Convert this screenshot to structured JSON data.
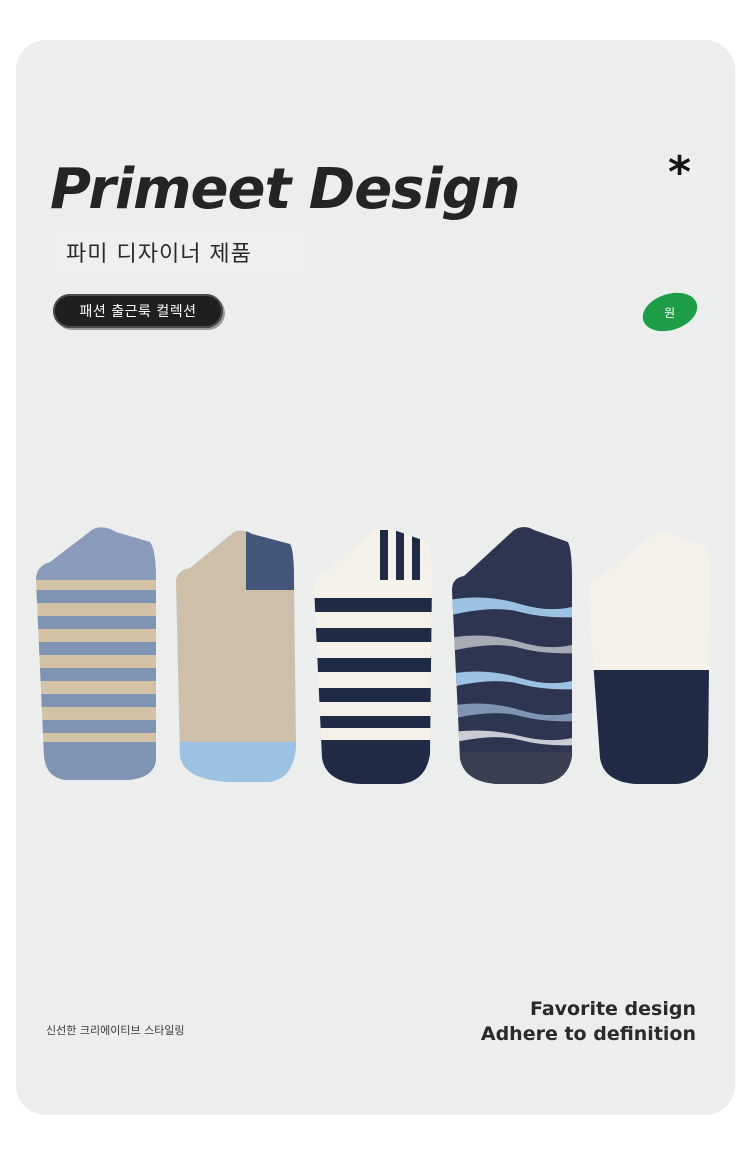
{
  "header": {
    "title": "Primeet Design",
    "asterisk": "*",
    "subtitle": "파미 디자이너 제품",
    "pill_label": "패션 출근룩 컬렉션",
    "badge_label": "원"
  },
  "product": {
    "image_name": "five-ankle-socks",
    "colors": {
      "card_background": "#eceded",
      "navy": "#1f2a44",
      "denim_blue": "#7f93b3",
      "beige": "#cdbfa9",
      "sky_blue": "#9cc2e3",
      "cream": "#f3f1ea",
      "badge_green": "#1c9d46"
    }
  },
  "footer": {
    "left_caption": "신선한 크리에이티브 스타일링",
    "right_line1": "Favorite design",
    "right_line2": "Adhere to definition"
  }
}
